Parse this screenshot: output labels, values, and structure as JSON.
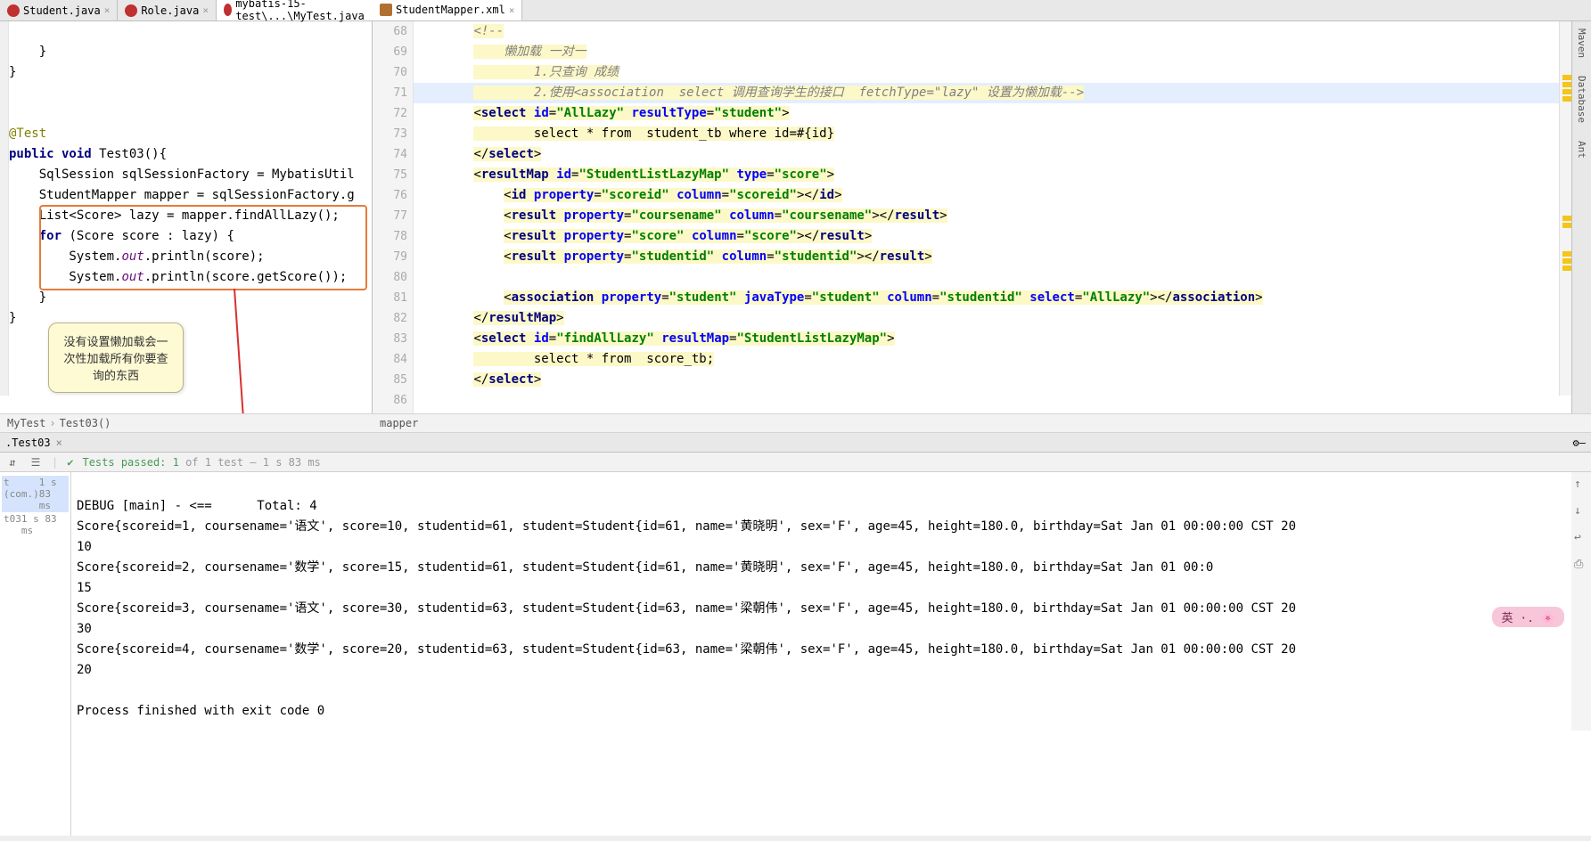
{
  "tabs_left": [
    {
      "label": "Student.java",
      "icon": "java"
    },
    {
      "label": "Role.java",
      "icon": "java"
    },
    {
      "label": "mybatis-15-test\\...\\MyTest.java",
      "icon": "java"
    }
  ],
  "tabs_right": [
    {
      "label": "StudentMapper.xml",
      "icon": "xml"
    }
  ],
  "left_code": {
    "l1": "    }",
    "l2": "}",
    "l3": "",
    "l4": "",
    "l5_ann": "@Test",
    "l6a": "public void",
    "l6b": " Test03(){",
    "l7": "    SqlSession sqlSessionFactory = MybatisUtil",
    "l8": "    StudentMapper mapper = sqlSessionFactory.g",
    "l9": "    List<Score> lazy = mapper.findAllLazy();",
    "l10a": "    for",
    "l10b": " (Score score : lazy) {",
    "l11a": "        System.",
    "l11o": "out",
    "l11b": ".println(score);",
    "l12a": "        System.",
    "l12o": "out",
    "l12b": ".println(score.getScore());",
    "l13": "    }",
    "l14": "}"
  },
  "callout_text": {
    "l1": "没有设置懒加载会一",
    "l2": "次性加载所有你要查",
    "l3": "询的东西"
  },
  "right_lines": {
    "start": 68,
    "l68": "<!--",
    "l69": "    懒加载 一对一",
    "l70": "        1.只查询 成绩",
    "l71": "        2.使用<association  select 调用查询学生的接口  fetchType=\"lazy\" 设置为懒加载-->",
    "l72": {
      "tag": "select",
      "attrs": [
        [
          "id",
          "AllLazy"
        ],
        [
          "resultType",
          "student"
        ]
      ],
      "open": true
    },
    "l73": "        select * from  student_tb where id=#{id}",
    "l74_close": "select",
    "l75": {
      "tag": "resultMap",
      "attrs": [
        [
          "id",
          "StudentListLazyMap"
        ],
        [
          "type",
          "score"
        ]
      ],
      "open": true
    },
    "l76": {
      "tag": "id",
      "attrs": [
        [
          "property",
          "scoreid"
        ],
        [
          "column",
          "scoreid"
        ]
      ],
      "self": true,
      "close": "id"
    },
    "l77": {
      "tag": "result",
      "attrs": [
        [
          "property",
          "coursename"
        ],
        [
          "column",
          "coursename"
        ]
      ],
      "self": true,
      "close": "result"
    },
    "l78": {
      "tag": "result",
      "attrs": [
        [
          "property",
          "score"
        ],
        [
          "column",
          "score"
        ]
      ],
      "self": true,
      "close": "result"
    },
    "l79": {
      "tag": "result",
      "attrs": [
        [
          "property",
          "studentid"
        ],
        [
          "column",
          "studentid"
        ]
      ],
      "self": true,
      "close": "result"
    },
    "l80": "",
    "l81": {
      "tag": "association",
      "attrs": [
        [
          "property",
          "student"
        ],
        [
          "javaType",
          "student"
        ],
        [
          "column",
          "studentid"
        ],
        [
          "select",
          "AllLazy"
        ]
      ],
      "self": true,
      "close": "association"
    },
    "l82_close": "resultMap",
    "l83": {
      "tag": "select",
      "attrs": [
        [
          "id",
          "findAllLazy"
        ],
        [
          "resultMap",
          "StudentListLazyMap"
        ]
      ],
      "open": true
    },
    "l84": "        select * from  score_tb;",
    "l85_close": "select",
    "l86": ""
  },
  "crumbs_left": {
    "a": "MyTest",
    "b": "Test03()"
  },
  "crumbs_right": "mapper",
  "run_tab_label": ".Test03",
  "test_summary_pre": "Tests passed: 1",
  "test_summary_post": " of 1 test – 1 s 83 ms",
  "tree": [
    {
      "label": "t (com.)",
      "time": "1 s 83 ms"
    },
    {
      "label": "t03",
      "time": "1 s 83 ms"
    }
  ],
  "console": {
    "l1": "DEBUG [main] - <==      Total: 4",
    "l2": "Score{scoreid=1, coursename='语文', score=10, studentid=61, student=Student{id=61, name='黄晓明', sex='F', age=45, height=180.0, birthday=Sat Jan 01 00:00:00 CST 20",
    "l3": "10",
    "l4": "Score{scoreid=2, coursename='数学', score=15, studentid=61, student=Student{id=61, name='黄晓明', sex='F', age=45, height=180.0, birthday=Sat Jan 01 00:0",
    "l5": "15",
    "l6": "Score{scoreid=3, coursename='语文', score=30, studentid=63, student=Student{id=63, name='梁朝伟', sex='F', age=45, height=180.0, birthday=Sat Jan 01 00:00:00 CST 20",
    "l7": "30",
    "l8": "Score{scoreid=4, coursename='数学', score=20, studentid=63, student=Student{id=63, name='梁朝伟', sex='F', age=45, height=180.0, birthday=Sat Jan 01 00:00:00 CST 20",
    "l9": "20",
    "l10": "",
    "l11": "Process finished with exit code 0"
  },
  "side_tools": [
    "Maven",
    "Database",
    "Ant"
  ],
  "ime": "英",
  "run_side_icons": [
    "up-icon",
    "down-icon",
    "wrap-icon",
    "print-icon"
  ]
}
